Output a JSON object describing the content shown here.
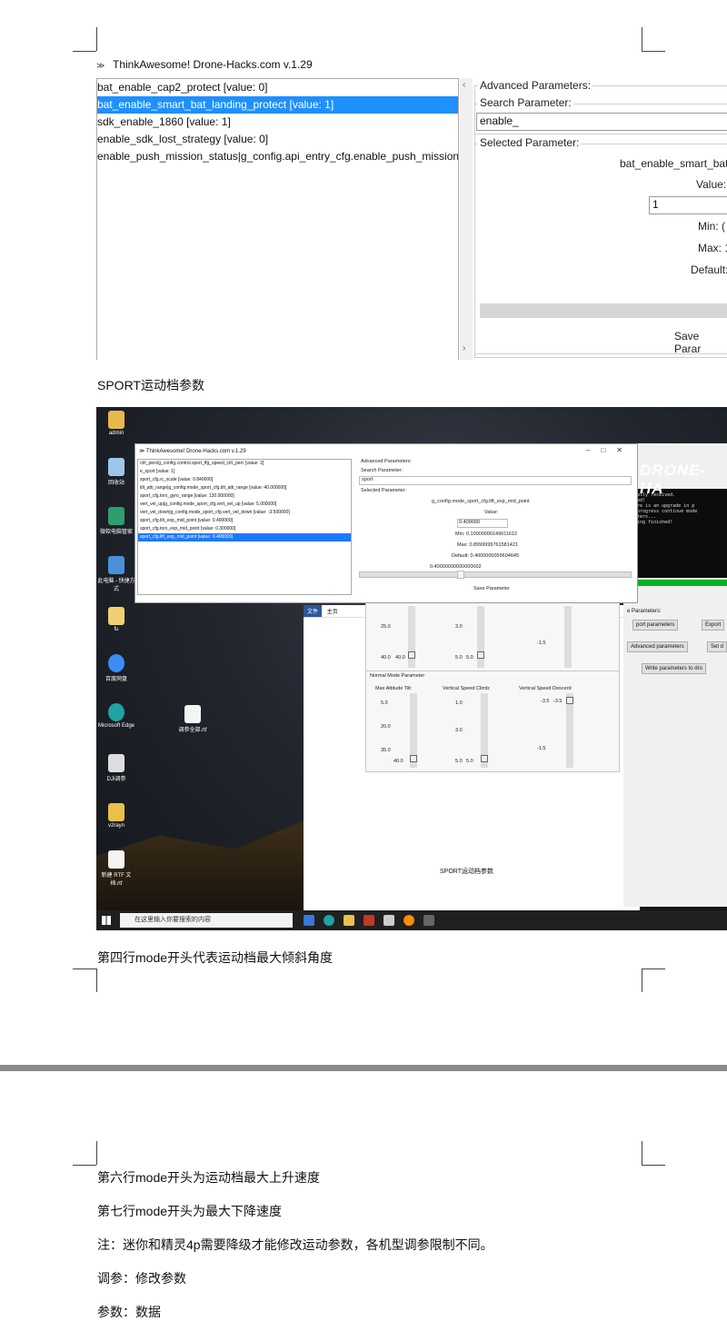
{
  "drone_tool": {
    "title": "ThinkAwesome! Drone-Hacks.com v.1.29",
    "param_list": [
      "bat_enable_cap2_protect [value: 0]",
      "bat_enable_smart_bat_landing_protect [value: 1]",
      "sdk_enable_1860 [value: 1]",
      "enable_sdk_lost_strategy [value: 0]",
      "enable_push_mission_status|g_config.api_entry_cfg.enable_push_mission_"
    ],
    "selected_index": 1,
    "advanced_label": "Advanced Parameters:",
    "search_label": "Search Parameter:",
    "search_value": "enable_",
    "selected_label": "Selected Parameter:",
    "selected_name": "bat_enable_smart_bat",
    "value_label": "Value:",
    "value_input": "1",
    "min_label": "Min: (",
    "max_label": "Max: 1",
    "default_label": "Default:",
    "save_button": "Save Parar"
  },
  "text": {
    "caption_sport": "SPORT运动档参数",
    "line_fourth": "第四行mode开头代表运动档最大倾斜角度",
    "line_sixth": "第六行mode开头为运动档最大上升速度",
    "line_seventh": "第七行mode开头为最大下降速度",
    "note": "注：迷你和精灵4p需要降级才能修改运动参数，各机型调参限制不同。",
    "tuning": "调参：修改参数",
    "params": "参数：数据"
  },
  "desktop": {
    "icons": [
      "admin",
      "回收站",
      "微软电脑管家",
      "此电脑 - 快捷方式",
      "fu",
      "百度网盘",
      "Microsoft Edge",
      "DJI调参",
      "v2rayn",
      "新建 RTF 文档.rtf"
    ],
    "file_icon": "调参全部.rtf",
    "search_placeholder": "在这里输入你要搜索的内容",
    "word_tabs": [
      "文件",
      "主页"
    ],
    "word_caption": "SPORT运动档参数",
    "drone_banner": "DRONE-HA",
    "console_lines": [
      "rtually received.",
      "ected!",
      "There is an upgrade in p",
      "in progress continue mode",
      "ameters...",
      "eading finished!"
    ],
    "side_buttons": [
      "port parameters",
      "Export",
      "Advanced parameters",
      "Set d",
      "Write parameters to dro"
    ],
    "side_group_label": "e Parameters:",
    "inner_window": {
      "title": "ThinkAwesome! Drone-Hacks.com v.1.29",
      "list": [
        "ctrl_perclg_config.control.sport_ffg_speed_ctrl_perc [value: 2]",
        "e_sport [value: 1]",
        "sport_cfg.rc_scale [value: 0.840000]",
        "tilt_atti_range|g_config.mode_sport_cfg.tilt_atti_range [value: 40.000000]",
        "sport_cfg.torx_gyro_range [value: 130.000000]",
        "vert_vel_up|g_config.mode_sport_cfg.vert_vel_up [value: 5.000000]",
        "vert_vel_down|g_config.mode_sport_cfg.vert_vel_down [value: -3.500000]",
        "sport_cfg.tilt_exp_mid_point [value: 0.400000]",
        "sport_cfg.torx_exp_mid_point [value: 0.300000]",
        "sport_cfg.lift_exp_mid_point [value: 0.400000]"
      ],
      "selected_index": 9,
      "advanced_label": "Advanced Parameters:",
      "search_label": "Search Parameter:",
      "search_value": "sport",
      "selected_label": "Selected Parameter:",
      "selected_name": "g_config.mode_sport_cfg.lift_exp_mid_point",
      "value_label": "Value:",
      "value_input": "0.400000",
      "min": "Min: 0.10000000149011612",
      "max": "Max: 0.8999999761581421",
      "default": "Default: 0.4000000059604645",
      "slider_value": "0.40000000000000002",
      "save_button": "Save Parameter"
    },
    "sport_sliders": {
      "row1": [
        "25.0",
        "40.0",
        "40.0",
        "3.0",
        "5.0",
        "5.0",
        "-1.5"
      ],
      "normal_label": "Normal Mode Parameter",
      "headers": [
        "Max Attitude Tilt:",
        "Vertical Speed Climb:",
        "Vertical Speed Descent:"
      ],
      "row2": [
        "5.0",
        "20.0",
        "35.0",
        "40.0",
        "1.0",
        "3.0",
        "5.0",
        "5.0",
        "-3.5",
        "-3.5",
        "-1.5"
      ]
    }
  }
}
